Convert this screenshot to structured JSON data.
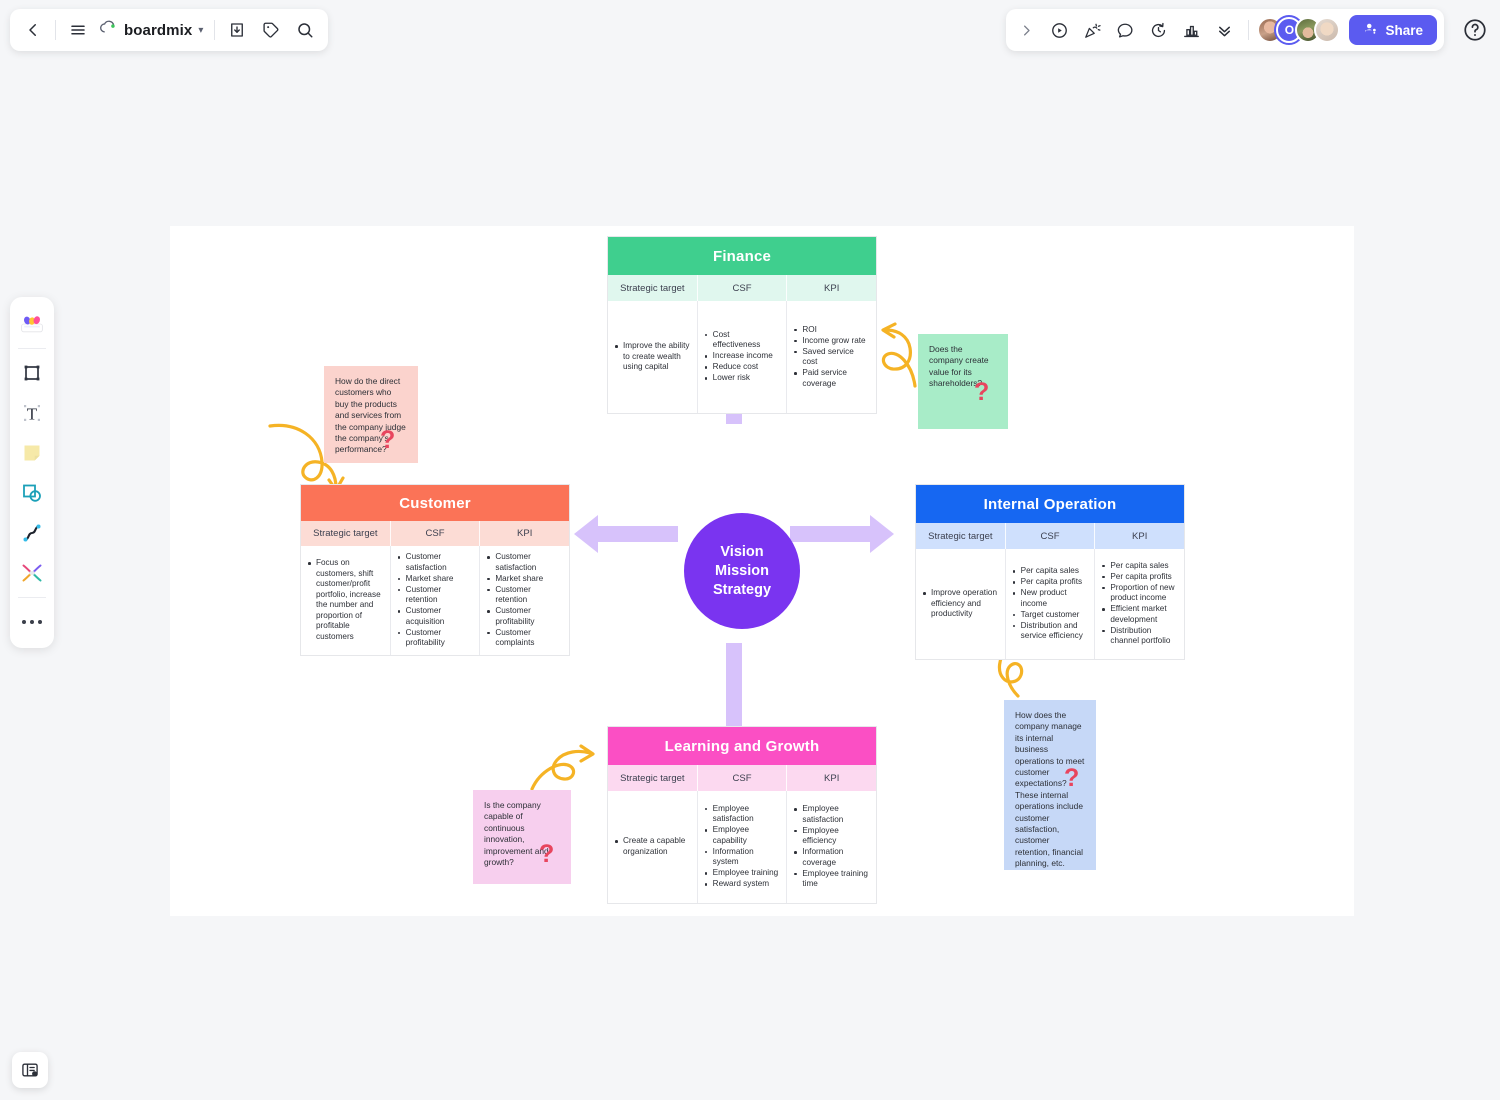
{
  "app": {
    "brand_name": "boardmix",
    "brand_chevron": "chevron-down-icon"
  },
  "topbar_left": {
    "back_label": "Back",
    "menu_label": "Menu",
    "export_label": "Export",
    "tag_label": "Tag",
    "search_label": "Search"
  },
  "topbar_right": {
    "expand_label": "Expand",
    "present_label": "Present",
    "celebrate_label": "Celebrate",
    "comment_label": "Comment",
    "timer_label": "Timer",
    "vote_label": "Vote",
    "more_label": "More",
    "share_label": "Share",
    "help_label": "Help",
    "me_initial": "O",
    "accent_color": "#5b5bf0"
  },
  "left_rail": {
    "items": [
      {
        "name": "template-library",
        "label": "Templates"
      },
      {
        "name": "frame-tool",
        "label": "Frame"
      },
      {
        "name": "text-tool",
        "label": "Text"
      },
      {
        "name": "sticky-note-tool",
        "label": "Sticky note"
      },
      {
        "name": "shape-tool",
        "label": "Shape"
      },
      {
        "name": "pen-tool",
        "label": "Pen"
      },
      {
        "name": "connector-tool",
        "label": "Connector"
      },
      {
        "name": "more-tools",
        "label": "More tools"
      }
    ]
  },
  "bottom_left": {
    "label": "Board panel"
  },
  "hub": {
    "lines": [
      "Vision",
      "Mission",
      "Strategy"
    ],
    "color": "#7a34f0",
    "arrow_color": "#d7c2fb"
  },
  "columns": [
    "Strategic target",
    "CSF",
    "KPI"
  ],
  "perspectives": [
    {
      "id": "finance",
      "title": "Finance",
      "title_color": "#3fcf8e",
      "header_color": "#e0f7ee",
      "strategic_target": [
        "Improve the ability to create wealth using capital"
      ],
      "csf": [
        "Cost effectiveness",
        "Increase income",
        "Reduce cost",
        "Lower risk"
      ],
      "kpi": [
        "ROI",
        "Income grow rate",
        "Saved service cost",
        "Paid service coverage"
      ]
    },
    {
      "id": "customer",
      "title": "Customer",
      "title_color": "#fb7357",
      "header_color": "#fcdcd5",
      "strategic_target": [
        "Focus on customers, shift customer/profit portfolio, increase the number and proportion of profitable customers"
      ],
      "csf": [
        "Customer satisfaction",
        "Market share",
        "Customer retention",
        "Customer acquisition",
        "Customer profitability"
      ],
      "kpi": [
        "Customer satisfaction",
        "Market share",
        "Customer retention",
        "Customer profitability",
        "Customer complaints"
      ]
    },
    {
      "id": "internal",
      "title": "Internal Operation",
      "title_color": "#1667f2",
      "header_color": "#cfe0fd",
      "strategic_target": [
        "Improve operation efficiency and productivity"
      ],
      "csf": [
        "Per capita sales",
        "Per capita profits",
        "New product income",
        "Target customer",
        "Distribution and service efficiency"
      ],
      "kpi": [
        "Per capita sales",
        "Per capita profits",
        "Proportion of new product income",
        "Efficient market development",
        "Distribution channel portfolio"
      ]
    },
    {
      "id": "learning",
      "title": "Learning and Growth",
      "title_color": "#fb4fc4",
      "header_color": "#fcd9f0",
      "strategic_target": [
        "Create a capable organization"
      ],
      "csf": [
        "Employee satisfaction",
        "Employee capability",
        "Information system",
        "Employee training",
        "Reward system"
      ],
      "kpi": [
        "Employee satisfaction",
        "Employee efficiency",
        "Information coverage",
        "Employee training time"
      ]
    }
  ],
  "notes": {
    "customer": {
      "text": "How do the direct customers who buy the products and services from the company judge the company's performance?",
      "color": "#fbd3cd",
      "mark": "?"
    },
    "finance": {
      "text": "Does the company create value for its shareholders?",
      "color": "#a8ecc8",
      "mark": "?"
    },
    "learning": {
      "text": "Is the company capable of continuous innovation, improvement and growth?",
      "color": "#f7cfee",
      "mark": "?"
    },
    "internal": {
      "text": "How does the company manage its internal business operations to meet customer expectations? These internal operations include customer satisfaction, customer retention, financial planning, etc.",
      "color": "#c6d8f7",
      "mark": "?"
    }
  }
}
